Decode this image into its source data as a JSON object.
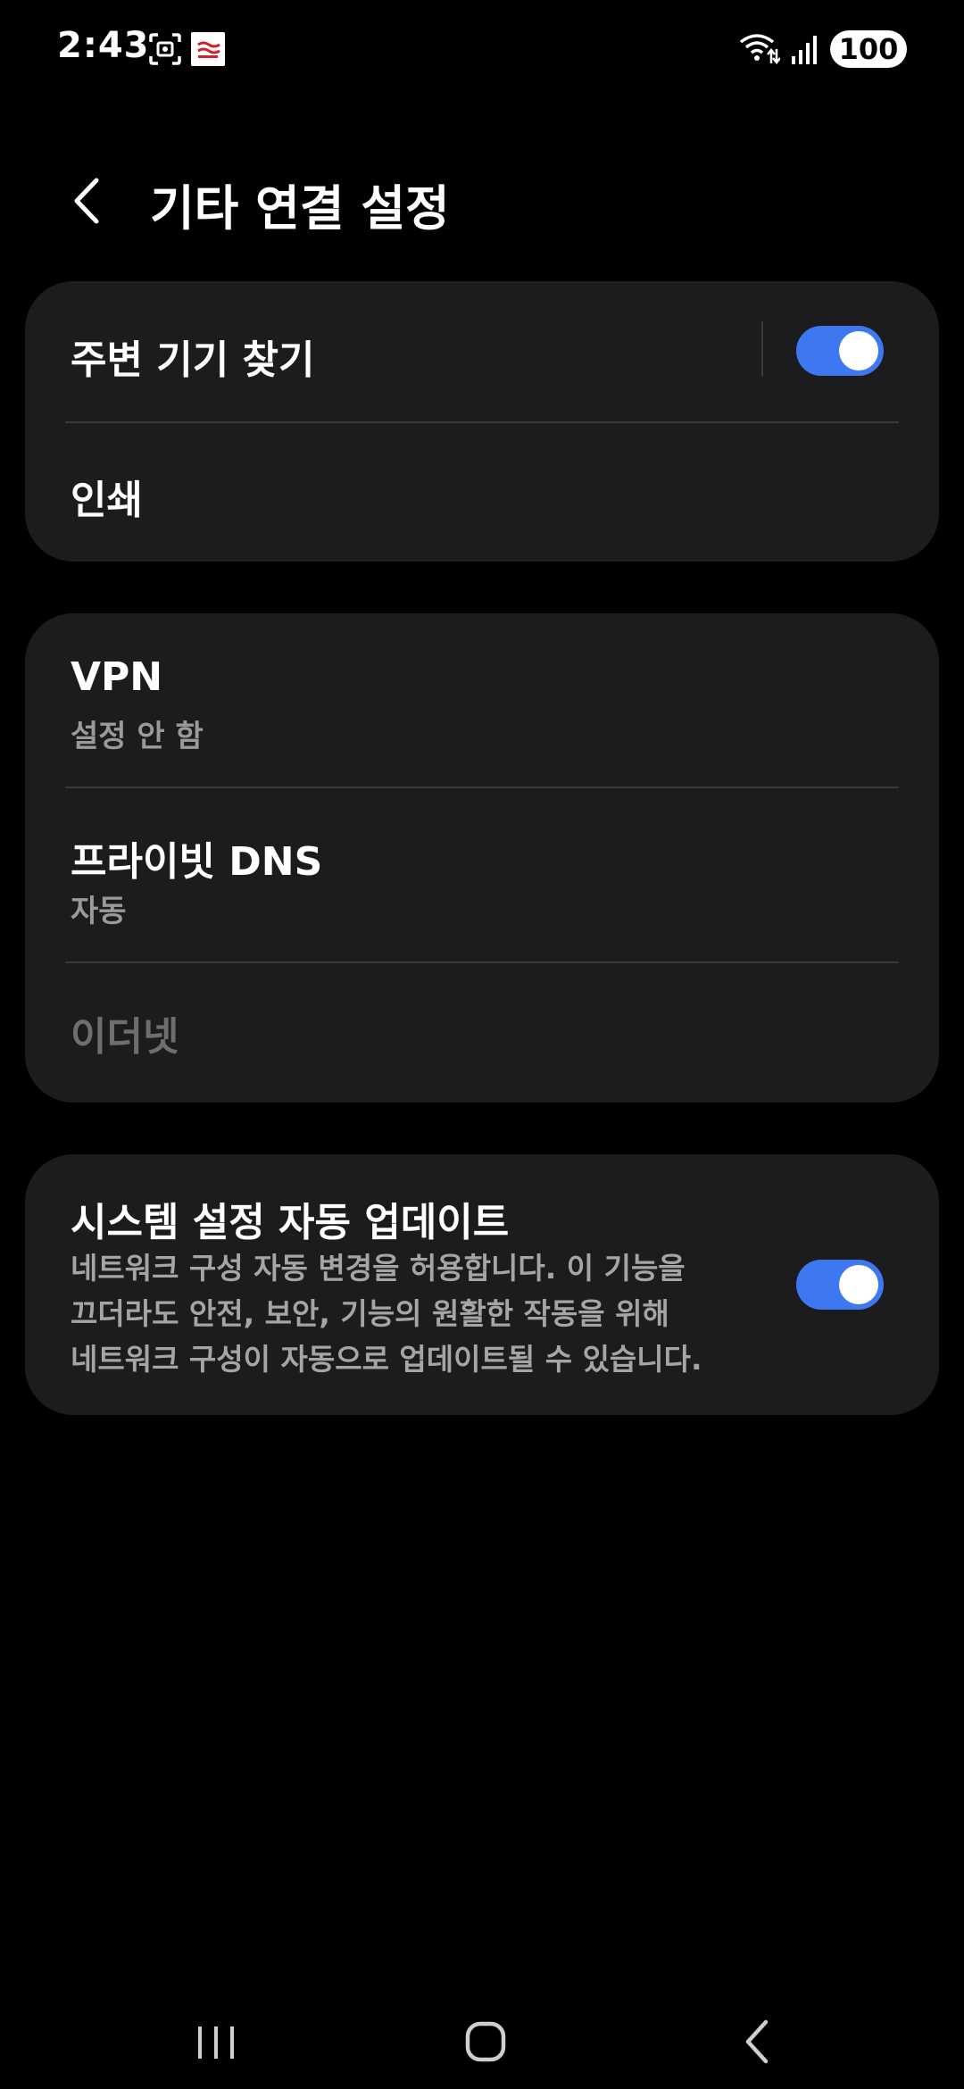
{
  "status_bar": {
    "time": "2:43",
    "battery": "100",
    "icons": [
      "screenshot-icon",
      "app-notification-icon",
      "wifi-icon",
      "signal-icon",
      "battery-icon"
    ]
  },
  "header": {
    "title": "기타 연결 설정",
    "back_icon": "chevron-left-icon"
  },
  "sections": [
    {
      "items": [
        {
          "title": "주변 기기 찾기",
          "toggle": true,
          "toggle_on": true
        },
        {
          "title": "인쇄"
        }
      ]
    },
    {
      "items": [
        {
          "title": "VPN",
          "subtitle": "설정 안 함"
        },
        {
          "title": "프라이빗 DNS",
          "subtitle": "자동"
        },
        {
          "title": "이더넷",
          "disabled": true
        }
      ]
    },
    {
      "items": [
        {
          "title": "시스템 설정 자동 업데이트",
          "description_lines": [
            "네트워크 구성 자동 변경을 허용합니다. 이 기능을",
            "끄더라도 안전, 보안, 기능의 원활한 작동을 위해",
            "네트워크 구성이 자동으로 업데이트될 수 있습니다."
          ],
          "toggle": true,
          "toggle_on": true
        }
      ]
    }
  ],
  "nav_bar": {
    "icons": [
      "recent-apps-icon",
      "home-icon",
      "back-icon"
    ]
  },
  "colors": {
    "background": "#000000",
    "card": "#1c1c1e",
    "accent": "#3e78f0",
    "divider": "#3a3a3c",
    "subtitle": "#9a9a9a",
    "disabled": "#6e6e70"
  }
}
